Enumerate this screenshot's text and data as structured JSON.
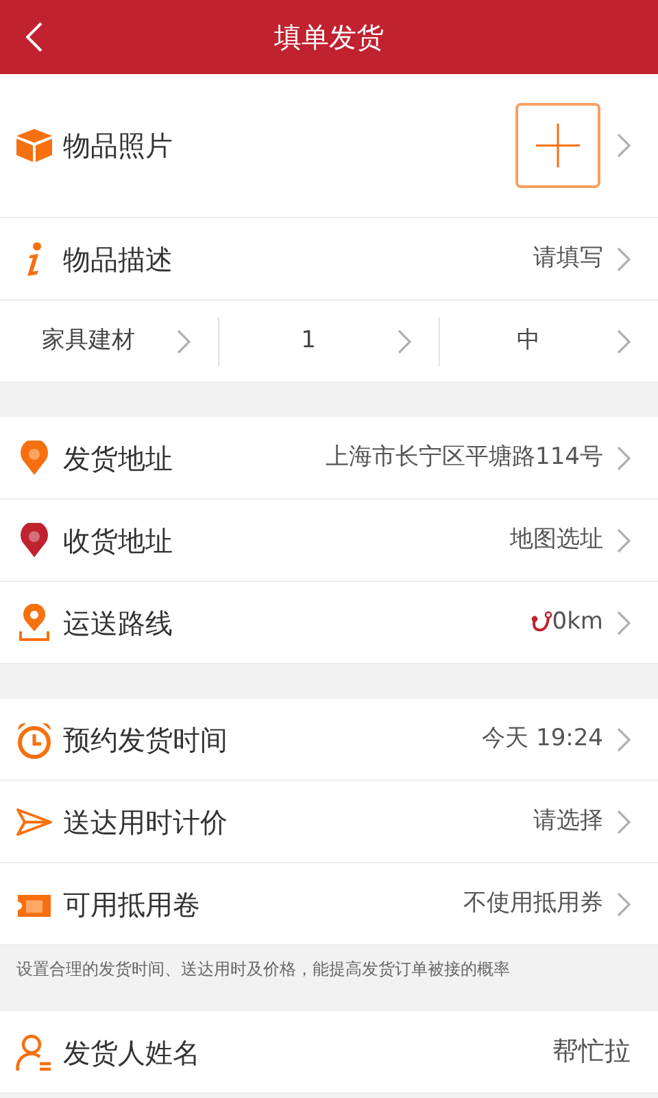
{
  "header": {
    "title": "填单发货"
  },
  "sections": [
    {
      "rows": [
        {
          "kind": "photo",
          "label": "物品照片"
        },
        {
          "kind": "link",
          "label": "物品描述",
          "value": "请填写"
        },
        {
          "kind": "triple",
          "cells": [
            "家具建材",
            "1",
            "中"
          ]
        }
      ]
    },
    {
      "rows": [
        {
          "kind": "link",
          "label": "发货地址",
          "value": "上海市长宁区平塘路114号"
        },
        {
          "kind": "link",
          "label": "收货地址",
          "value": "地图选址"
        },
        {
          "kind": "route",
          "label": "运送路线",
          "value": "0km"
        }
      ]
    },
    {
      "rows": [
        {
          "kind": "link",
          "label": "预约发货时间",
          "value": "今天 19:24"
        },
        {
          "kind": "link",
          "label": "送达用时计价",
          "value": "请选择"
        },
        {
          "kind": "link",
          "label": "可用抵用卷",
          "value": "不使用抵用券"
        }
      ],
      "note": "设置合理的发货时间、送达用时及价格，能提高发货订单被接的概率"
    },
    {
      "rows": [
        {
          "kind": "text",
          "label": "发货人姓名",
          "value": "帮忙拉"
        }
      ]
    }
  ]
}
